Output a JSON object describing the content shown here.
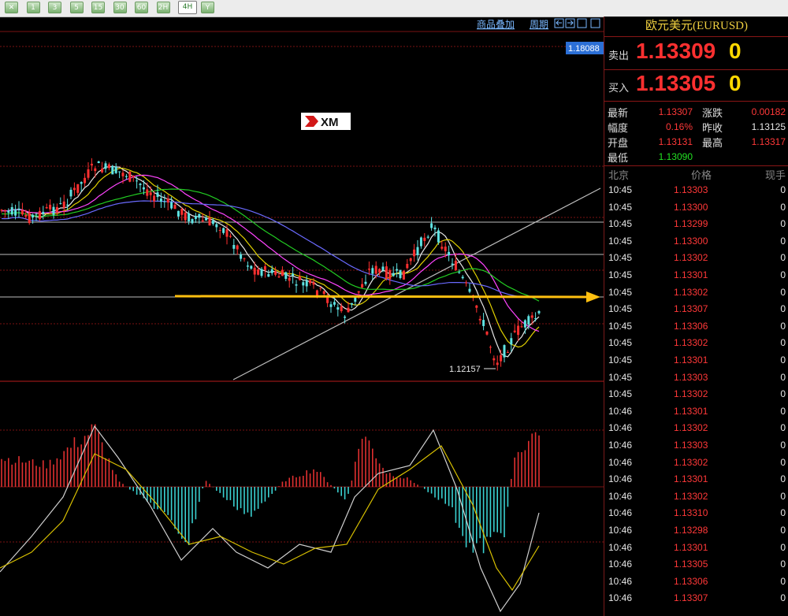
{
  "toolbar": {
    "buttons": [
      {
        "name": "tool-x-button",
        "label": "✕"
      },
      {
        "name": "period-1-button",
        "label": "1"
      },
      {
        "name": "period-3-button",
        "label": "3"
      },
      {
        "name": "period-5-button",
        "label": "5"
      },
      {
        "name": "period-15-button",
        "label": "15"
      },
      {
        "name": "period-30-button",
        "label": "30"
      },
      {
        "name": "period-60-button",
        "label": "60"
      },
      {
        "name": "period-2h-button",
        "label": "2H"
      },
      {
        "name": "period-4h-button",
        "label": "4H"
      },
      {
        "name": "period-y-button",
        "label": "Y"
      }
    ],
    "selected": "period-4h-button"
  },
  "chart": {
    "overlay_link": "商品叠加",
    "period_link": "周期",
    "price_tag": "1.18088",
    "low_label": "1.12157",
    "logo_text": "XM",
    "colors": {
      "bull": "#5fe3e3",
      "bear": "#ff3030",
      "ma1": "#e8e8e8",
      "ma2": "#e0d000",
      "ma3": "#ff44ff",
      "ma4": "#22cc22",
      "ma5": "#6a6aff",
      "arrow": "#ffc010",
      "grid": "#7a1212"
    }
  },
  "quote": {
    "title": "欧元美元(EURUSD)",
    "sell_label": "卖出",
    "sell_price": "1.13309",
    "sell_vol": "0",
    "buy_label": "买入",
    "buy_price": "1.13305",
    "buy_vol": "0",
    "stats": {
      "latest_label": "最新",
      "latest": "1.13307",
      "change_label": "涨跌",
      "change": "0.00182",
      "amp_label": "幅度",
      "amp": "0.16%",
      "prev_label": "昨收",
      "prev": "1.13125",
      "open_label": "开盘",
      "open": "1.13131",
      "high_label": "最高",
      "high": "1.13317",
      "low_label": "最低",
      "low": "1.13090"
    },
    "table_header": {
      "time": "北京",
      "price": "价格",
      "vol": "现手"
    },
    "ticks": [
      {
        "time": "10:45",
        "price": "1.13303",
        "vol": "0"
      },
      {
        "time": "10:45",
        "price": "1.13300",
        "vol": "0"
      },
      {
        "time": "10:45",
        "price": "1.13299",
        "vol": "0"
      },
      {
        "time": "10:45",
        "price": "1.13300",
        "vol": "0"
      },
      {
        "time": "10:45",
        "price": "1.13302",
        "vol": "0"
      },
      {
        "time": "10:45",
        "price": "1.13301",
        "vol": "0"
      },
      {
        "time": "10:45",
        "price": "1.13302",
        "vol": "0"
      },
      {
        "time": "10:45",
        "price": "1.13307",
        "vol": "0"
      },
      {
        "time": "10:45",
        "price": "1.13306",
        "vol": "0"
      },
      {
        "time": "10:45",
        "price": "1.13302",
        "vol": "0"
      },
      {
        "time": "10:45",
        "price": "1.13301",
        "vol": "0"
      },
      {
        "time": "10:45",
        "price": "1.13303",
        "vol": "0"
      },
      {
        "time": "10:45",
        "price": "1.13302",
        "vol": "0"
      },
      {
        "time": "10:46",
        "price": "1.13301",
        "vol": "0"
      },
      {
        "time": "10:46",
        "price": "1.13302",
        "vol": "0"
      },
      {
        "time": "10:46",
        "price": "1.13303",
        "vol": "0"
      },
      {
        "time": "10:46",
        "price": "1.13302",
        "vol": "0"
      },
      {
        "time": "10:46",
        "price": "1.13301",
        "vol": "0"
      },
      {
        "time": "10:46",
        "price": "1.13302",
        "vol": "0"
      },
      {
        "time": "10:46",
        "price": "1.13310",
        "vol": "0"
      },
      {
        "time": "10:46",
        "price": "1.13298",
        "vol": "0"
      },
      {
        "time": "10:46",
        "price": "1.13301",
        "vol": "0"
      },
      {
        "time": "10:46",
        "price": "1.13305",
        "vol": "0"
      },
      {
        "time": "10:46",
        "price": "1.13306",
        "vol": "0"
      },
      {
        "time": "10:46",
        "price": "1.13307",
        "vol": "0"
      }
    ]
  }
}
